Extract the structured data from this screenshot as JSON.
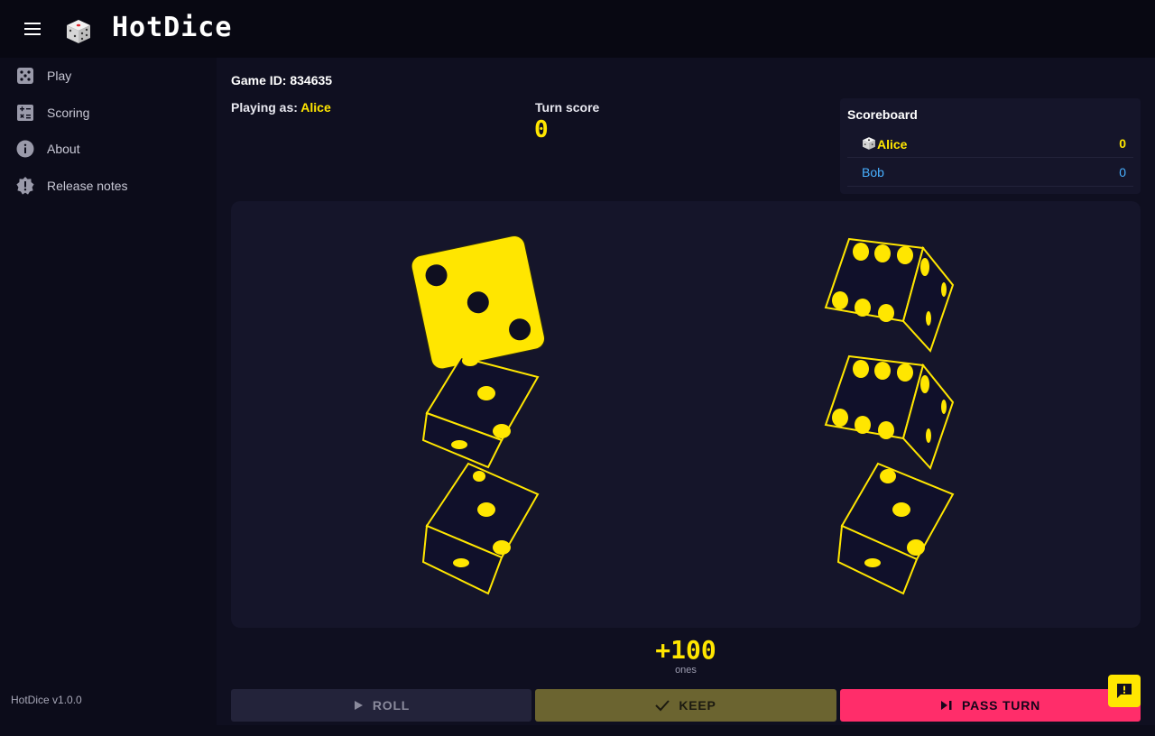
{
  "app": {
    "title": "HotDice",
    "version": "HotDice v1.0.0",
    "icons": {
      "menu": "menu-icon",
      "logo": "dice-logo-icon"
    }
  },
  "sidebar": {
    "items": [
      {
        "label": "Play",
        "icon": "dice-icon"
      },
      {
        "label": "Scoring",
        "icon": "calculator-icon"
      },
      {
        "label": "About",
        "icon": "info-icon"
      },
      {
        "label": "Release notes",
        "icon": "badge-alert-icon"
      }
    ]
  },
  "game": {
    "id_label": "Game ID:",
    "id_value": "834635",
    "playing_as_label": "Playing as:",
    "player_name": "Alice",
    "turn_score_label": "Turn score",
    "turn_score": "0"
  },
  "scoreboard": {
    "title": "Scoreboard",
    "players": [
      {
        "name": "Alice",
        "score": "0",
        "active": true
      },
      {
        "name": "Bob",
        "score": "0",
        "active": false
      }
    ]
  },
  "dice": [
    {
      "face": 3,
      "selected": true
    },
    {
      "face": 3,
      "selected": false
    },
    {
      "face": 3,
      "selected": false
    },
    {
      "face": 6,
      "selected": false
    },
    {
      "face": 6,
      "selected": false
    },
    {
      "face": 3,
      "selected": false
    }
  ],
  "selection": {
    "points": "+100",
    "description": "ones"
  },
  "actions": {
    "roll": "ROLL",
    "keep": "KEEP",
    "pass_turn": "PASS TURN"
  },
  "colors": {
    "accent": "#ffe600",
    "pass": "#ff2d6a",
    "link": "#48b0ff",
    "background": "#0c0c1a"
  }
}
